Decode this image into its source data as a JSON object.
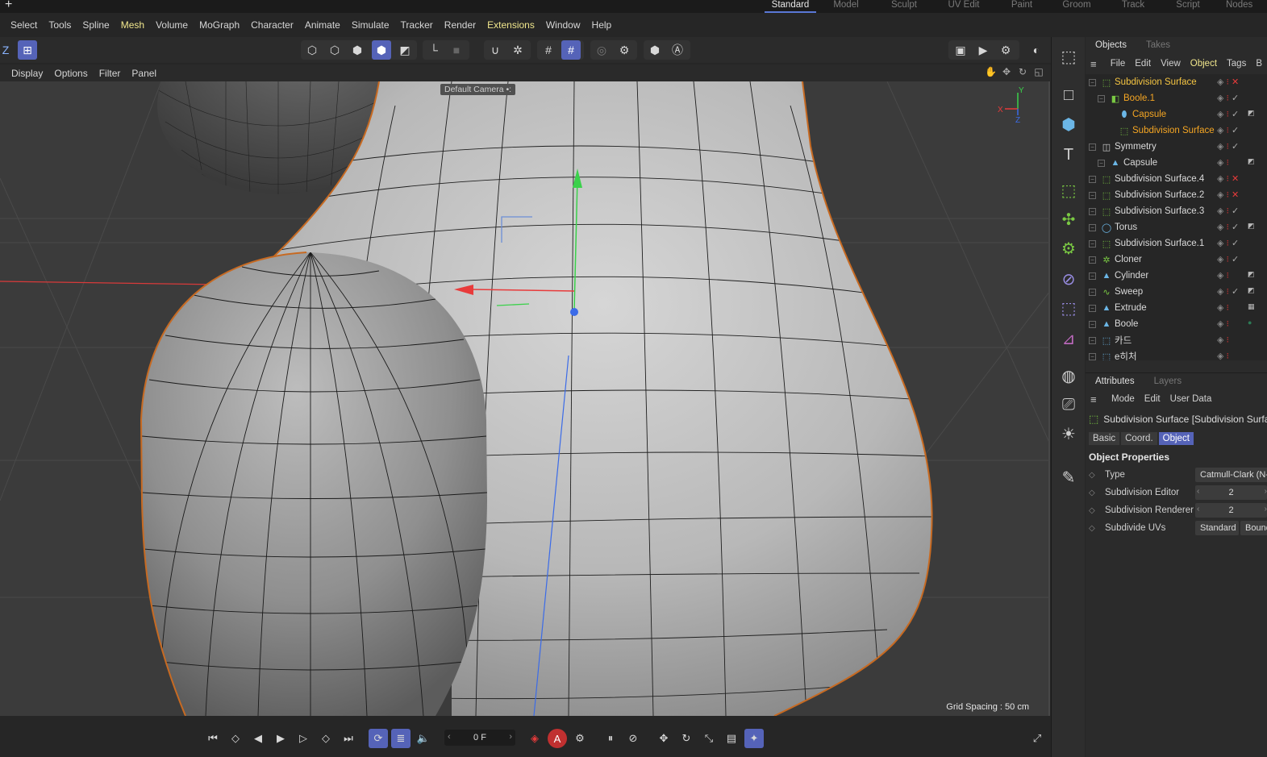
{
  "layout_tabs": [
    "Standard",
    "Model",
    "Sculpt",
    "UV Edit",
    "Paint",
    "Groom",
    "Track",
    "Script",
    "Nodes"
  ],
  "menu": [
    "Select",
    "Tools",
    "Spline",
    "Mesh",
    "Volume",
    "MoGraph",
    "Character",
    "Animate",
    "Simulate",
    "Tracker",
    "Render",
    "Extensions",
    "Window",
    "Help"
  ],
  "viewport_menu": [
    "Display",
    "Options",
    "Filter",
    "Panel"
  ],
  "viewport": {
    "camera": "Default Camera",
    "camera_suffix": "•:",
    "grid_spacing": "Grid Spacing : 50 cm",
    "axis_y": "Y",
    "axis_x": "X",
    "axis_z": "Z"
  },
  "toolbar": {
    "z_label": "Z"
  },
  "timeline": {
    "frame": "0 F"
  },
  "objects_panel": {
    "tabs": [
      "Objects",
      "Takes"
    ],
    "menu": [
      "File",
      "Edit",
      "View",
      "Object",
      "Tags",
      "B"
    ],
    "items": [
      {
        "name": "Subdivision Surface",
        "depth": 0,
        "selected": true,
        "icon": "subdivision-icon",
        "flag": "x",
        "tag": ""
      },
      {
        "name": "Boole.1",
        "depth": 1,
        "selected": true,
        "icon": "boole-icon",
        "flag": "check",
        "tag": ""
      },
      {
        "name": "Capsule",
        "depth": 2,
        "selected": true,
        "icon": "capsule-icon",
        "flag": "check",
        "tag": "phong"
      },
      {
        "name": "Subdivision Surface",
        "depth": 2,
        "selected": true,
        "icon": "subdivision-icon",
        "flag": "check",
        "tag": ""
      },
      {
        "name": "Symmetry",
        "depth": 0,
        "selected": false,
        "icon": "symmetry-icon",
        "flag": "check",
        "tag": ""
      },
      {
        "name": "Capsule",
        "depth": 1,
        "selected": false,
        "icon": "polygon-icon",
        "flag": "",
        "tag": "phong"
      },
      {
        "name": "Subdivision Surface.4",
        "depth": 0,
        "selected": false,
        "icon": "subdivision-icon",
        "flag": "x",
        "tag": ""
      },
      {
        "name": "Subdivision Surface.2",
        "depth": 0,
        "selected": false,
        "icon": "subdivision-icon",
        "flag": "x",
        "tag": ""
      },
      {
        "name": "Subdivision Surface.3",
        "depth": 0,
        "selected": false,
        "icon": "subdivision-icon",
        "flag": "check",
        "tag": ""
      },
      {
        "name": "Torus",
        "depth": 0,
        "selected": false,
        "icon": "torus-icon",
        "flag": "check",
        "tag": "phong"
      },
      {
        "name": "Subdivision Surface.1",
        "depth": 0,
        "selected": false,
        "icon": "subdivision-icon",
        "flag": "check",
        "tag": ""
      },
      {
        "name": "Cloner",
        "depth": 0,
        "selected": false,
        "icon": "cloner-icon",
        "flag": "check",
        "tag": ""
      },
      {
        "name": "Cylinder",
        "depth": 0,
        "selected": false,
        "icon": "polygon-icon",
        "flag": "",
        "tag": "phong"
      },
      {
        "name": "Sweep",
        "depth": 0,
        "selected": false,
        "icon": "sweep-icon",
        "flag": "check",
        "tag": "phong"
      },
      {
        "name": "Extrude",
        "depth": 0,
        "selected": false,
        "icon": "polygon-icon",
        "flag": "",
        "tag": "checker"
      },
      {
        "name": "Boole",
        "depth": 0,
        "selected": false,
        "icon": "polygon-icon",
        "flag": "",
        "tag": "material"
      },
      {
        "name": "카드",
        "depth": 0,
        "selected": false,
        "icon": "null-icon",
        "flag": "",
        "tag": ""
      },
      {
        "name": "e히처",
        "depth": 0,
        "selected": false,
        "icon": "null-icon",
        "flag": "",
        "tag": ""
      }
    ]
  },
  "attributes_panel": {
    "tabs": [
      "Attributes",
      "Layers"
    ],
    "menu": [
      "Mode",
      "Edit",
      "User Data"
    ],
    "header": "Subdivision Surface [Subdivision Surface]",
    "sub_tabs": [
      "Basic",
      "Coord.",
      "Object"
    ],
    "active_sub_tab": "Object",
    "section_title": "Object Properties",
    "properties": [
      {
        "label": "Type",
        "value": "Catmull-Clark (N-Gons)"
      },
      {
        "label": "Subdivision Editor",
        "value": "2"
      },
      {
        "label": "Subdivision Renderer",
        "value": "2"
      },
      {
        "label": "Subdivide UVs",
        "value": "Standard",
        "value2": "Boundary"
      }
    ]
  },
  "colors": {
    "accent": "#5563b8",
    "selected_object": "#f5a623",
    "highlight_menu": "#f0e68c",
    "axis_x": "#e83b3b",
    "axis_y": "#3bd14b",
    "axis_z": "#3b6be8"
  }
}
